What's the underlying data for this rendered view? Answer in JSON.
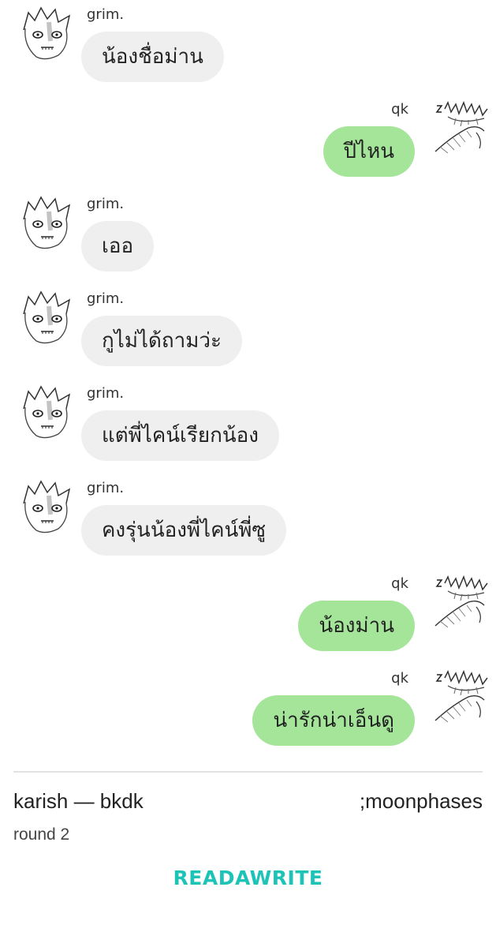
{
  "messages": [
    {
      "side": "left",
      "sender": "grim.",
      "text": "น้องชื่อม่าน"
    },
    {
      "side": "right",
      "sender": "qk",
      "text": "ปีไหน"
    },
    {
      "side": "left",
      "sender": "grim.",
      "text": "เออ"
    },
    {
      "side": "left",
      "sender": "grim.",
      "text": "กูไม่ได้ถามว่ะ"
    },
    {
      "side": "left",
      "sender": "grim.",
      "text": "แต่พี่ไคน์เรียกน้อง"
    },
    {
      "side": "left",
      "sender": "grim.",
      "text": "คงรุ่นน้องพี่ไคน์พี่ซู"
    },
    {
      "side": "right",
      "sender": "qk",
      "text": "น้องม่าน"
    },
    {
      "side": "right",
      "sender": "qk",
      "text": "น่ารักน่าเอ็นดู"
    }
  ],
  "footer": {
    "title": "karish — bkdk",
    "tag": ";moonphases",
    "subtitle": "round 2",
    "brand": "READAWRITE"
  },
  "colors": {
    "left_bubble": "#efefef",
    "right_bubble": "#a5e59a",
    "brand": "#1dc3b6"
  }
}
